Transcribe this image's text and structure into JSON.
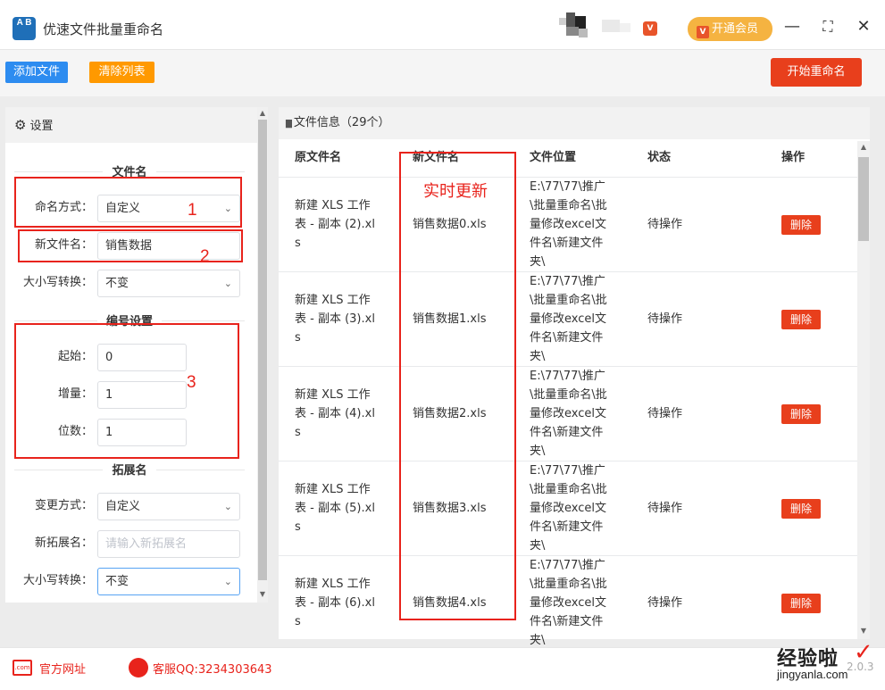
{
  "app": {
    "logo_text": "A B",
    "title": "优速文件批量重命名",
    "vip_mini": "V",
    "vip_icon": "V",
    "vip_label": "开通会员",
    "minimize": "—",
    "maximize": "⛶",
    "close": "✕"
  },
  "toolbar": {
    "add_files": "添加文件",
    "clear_list": "清除列表",
    "start_rename": "开始重命名"
  },
  "settings": {
    "header": "设置",
    "gear": "⚙",
    "section_filename": "文件名",
    "naming_mode_label": "命名方式：",
    "naming_mode_value": "自定义",
    "new_name_label": "新文件名：",
    "new_name_value": "销售数据",
    "case_label": "大小写转换：",
    "case_value": "不变",
    "section_numbering": "编号设置",
    "start_label": "起始：",
    "start_value": "0",
    "step_label": "增量：",
    "step_value": "1",
    "digits_label": "位数：",
    "digits_value": "1",
    "section_ext": "拓展名",
    "ext_mode_label": "变更方式：",
    "ext_mode_value": "自定义",
    "new_ext_label": "新拓展名：",
    "new_ext_placeholder": "请输入新拓展名",
    "ext_case_label": "大小写转换：",
    "ext_case_value": "不变",
    "chev": "⌄",
    "up": "▲",
    "down": "▼"
  },
  "annotations": {
    "n1": "1",
    "n2": "2",
    "n3": "3",
    "live": "实时更新"
  },
  "files": {
    "header": "文件信息（29个）",
    "doc_icon": "▇",
    "columns": [
      "原文件名",
      "新文件名",
      "文件位置",
      "状态",
      "操作"
    ],
    "rows": [
      {
        "orig": [
          "新建 XLS 工作",
          "表 - 副本 (2).xl",
          "s"
        ],
        "new": "销售数据0.xls",
        "path": [
          "E:\\77\\77\\推广",
          "\\批量重命名\\批",
          "量修改excel文",
          "件名\\新建文件",
          "夹\\"
        ],
        "status": "待操作",
        "action": "删除"
      },
      {
        "orig": [
          "新建 XLS 工作",
          "表 - 副本 (3).xl",
          "s"
        ],
        "new": "销售数据1.xls",
        "path": [
          "E:\\77\\77\\推广",
          "\\批量重命名\\批",
          "量修改excel文",
          "件名\\新建文件",
          "夹\\"
        ],
        "status": "待操作",
        "action": "删除"
      },
      {
        "orig": [
          "新建 XLS 工作",
          "表 - 副本 (4).xl",
          "s"
        ],
        "new": "销售数据2.xls",
        "path": [
          "E:\\77\\77\\推广",
          "\\批量重命名\\批",
          "量修改excel文",
          "件名\\新建文件",
          "夹\\"
        ],
        "status": "待操作",
        "action": "删除"
      },
      {
        "orig": [
          "新建 XLS 工作",
          "表 - 副本 (5).xl",
          "s"
        ],
        "new": "销售数据3.xls",
        "path": [
          "E:\\77\\77\\推广",
          "\\批量重命名\\批",
          "量修改excel文",
          "件名\\新建文件",
          "夹\\"
        ],
        "status": "待操作",
        "action": "删除"
      },
      {
        "orig": [
          "新建 XLS 工作",
          "表 - 副本 (6).xl",
          "s"
        ],
        "new": "销售数据4.xls",
        "path": [
          "E:\\77\\77\\推广",
          "\\批量重命名\\批",
          "量修改excel文",
          "件名\\新建文件",
          "夹\\"
        ],
        "status": "待操作",
        "action": "删除"
      }
    ]
  },
  "footer": {
    "site_icon": ".com",
    "site_label": "官方网址",
    "qq_label": "客服QQ:3234303643",
    "version": "2.0.3"
  },
  "watermark": {
    "line1": "经验啦",
    "line2": "jingyanla.com",
    "check": "✓"
  },
  "colors": {
    "primary": "#2d8cf0",
    "warning": "#ff9900",
    "danger": "#e83f1c",
    "annotation": "#e8231c"
  }
}
